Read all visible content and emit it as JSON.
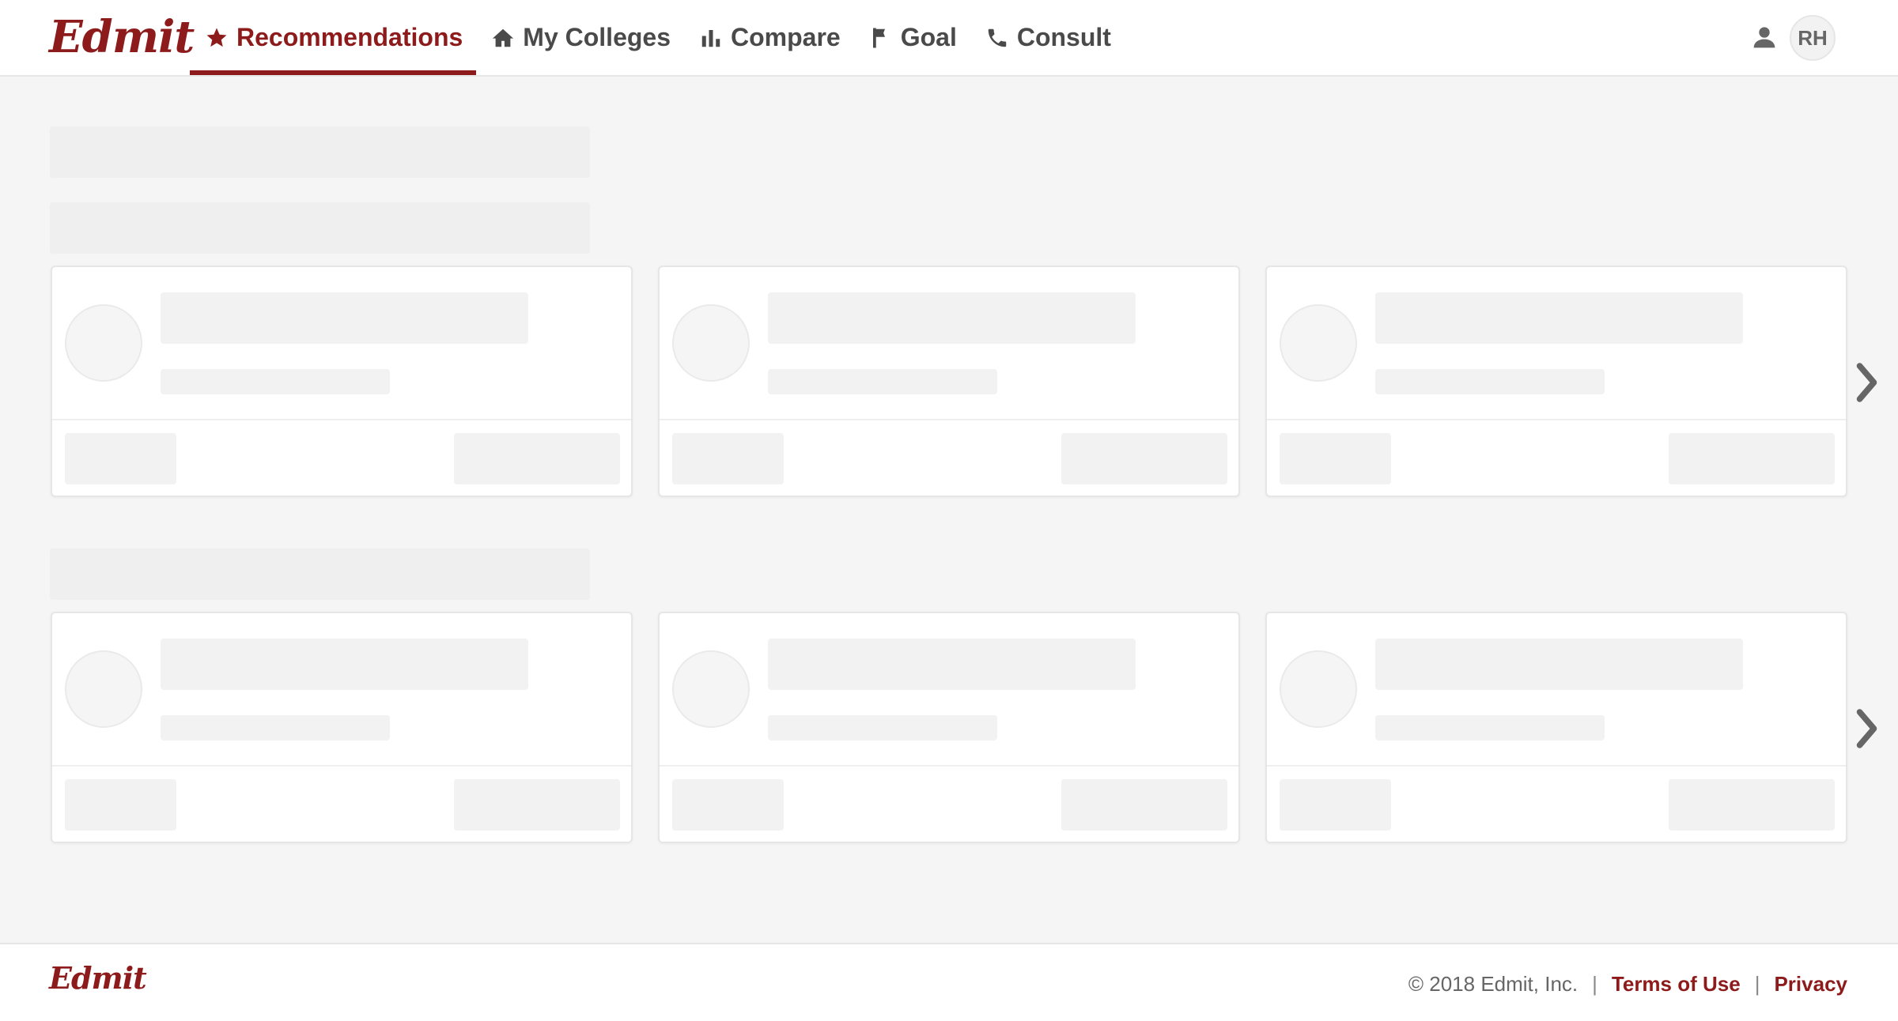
{
  "brand": {
    "name": "Edmit",
    "color": "#8e1b1b"
  },
  "nav": {
    "items": [
      {
        "label": "Recommendations",
        "icon": "star-icon",
        "active": true
      },
      {
        "label": "My Colleges",
        "icon": "home-icon",
        "active": false
      },
      {
        "label": "Compare",
        "icon": "bar-chart-icon",
        "active": false
      },
      {
        "label": "Goal",
        "icon": "flag-icon",
        "active": false
      },
      {
        "label": "Consult",
        "icon": "phone-icon",
        "active": false
      }
    ]
  },
  "user": {
    "initials": "RH",
    "icon": "user-icon"
  },
  "footer": {
    "brand": "Edmit",
    "copyright": "© 2018 Edmit, Inc.",
    "separator": "|",
    "terms_label": "Terms of Use",
    "privacy_label": "Privacy"
  },
  "colors": {
    "accent": "#8e1b1b",
    "page_background": "#f5f5f5",
    "skeleton": "#f2f2f2"
  }
}
